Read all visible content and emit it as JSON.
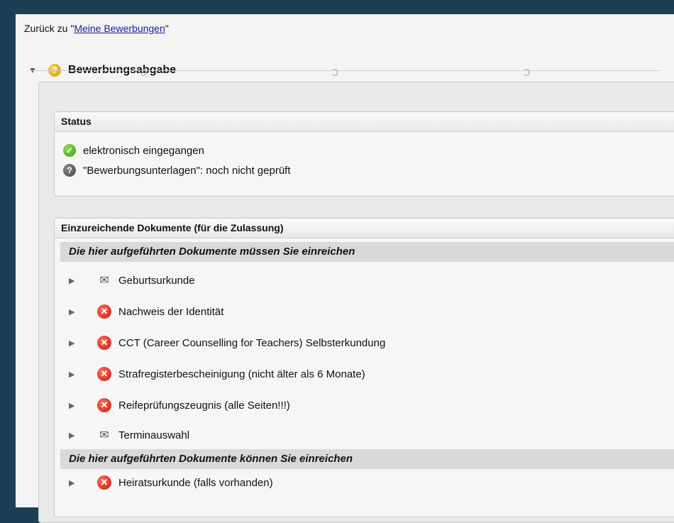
{
  "nav": {
    "back_prefix": "Zurück zu \"",
    "back_link": "Meine Bewerbungen",
    "back_suffix": "\""
  },
  "section": {
    "title": "Bewerbungsabgabe"
  },
  "status": {
    "header": "Status",
    "items": [
      {
        "icon": "check-icon",
        "text": "elektronisch eingegangen"
      },
      {
        "icon": "question-icon",
        "text": "\"Bewerbungsunterlagen\": noch nicht geprüft"
      }
    ]
  },
  "documents": {
    "header": "Einzureichende Dokumente (für die Zulassung)",
    "required_header": "Die hier aufgeführten Dokumente müssen Sie einreichen",
    "required": [
      {
        "icon": "envelope-icon",
        "label": "Geburtsurkunde"
      },
      {
        "icon": "error-icon",
        "label": "Nachweis der Identität"
      },
      {
        "icon": "error-icon",
        "label": "CCT (Career Counselling for Teachers) Selbsterkundung"
      },
      {
        "icon": "error-icon",
        "label": "Strafregisterbescheinigung (nicht älter als 6 Monate)"
      },
      {
        "icon": "error-icon",
        "label": "Reifeprüfungszeugnis (alle Seiten!!!)"
      },
      {
        "icon": "envelope-icon",
        "label": "Terminauswahl"
      }
    ],
    "optional_header": "Die hier aufgeführten Dokumente können Sie einreichen",
    "optional": [
      {
        "icon": "error-icon",
        "label": "Heiratsurkunde (falls vorhanden)"
      }
    ]
  },
  "colors": {
    "frame": "#1c3f55",
    "page": "#f4f4f4",
    "link": "#1a1aa6",
    "error": "#d8261a",
    "success": "#4caf21"
  }
}
